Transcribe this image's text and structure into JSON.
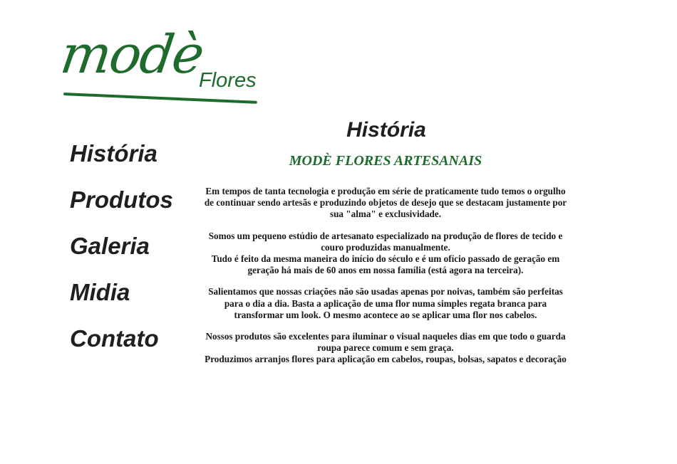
{
  "logo": {
    "word": "modè",
    "sub": "Flores",
    "color": "#1f6b2e"
  },
  "nav": {
    "items": [
      {
        "label": "História"
      },
      {
        "label": "Produtos"
      },
      {
        "label": "Galeria"
      },
      {
        "label": "Midia"
      },
      {
        "label": "Contato"
      }
    ]
  },
  "main": {
    "title": "História",
    "subtitle": "MODÈ FLORES ARTESANAIS",
    "paragraphs": [
      {
        "lines": [
          "Em tempos de tanta tecnologia e produção em série de praticamente tudo temos o orgulho de continuar sendo artesãs e produzindo objetos de desejo que se destacam justamente por sua \"alma\" e exclusividade."
        ]
      },
      {
        "lines": [
          "Somos um pequeno estúdio de artesanato especializado na produção de flores de tecido e couro produzidas manualmente.",
          "Tudo é feito da mesma maneira do início do século e é um ofício passado de geração em geração há mais de 60 anos em nossa família (está agora na terceira)."
        ]
      },
      {
        "lines": [
          "Salientamos que nossas criações não são usadas apenas por noivas, também são perfeitas para o dia a dia. Basta a aplicação de uma flor numa simples regata branca para transformar um look. O mesmo acontece ao se aplicar uma flor nos cabelos."
        ]
      },
      {
        "lines": [
          "Nossos produtos são excelentes para iluminar o visual naqueles dias em que todo o guarda roupa parece comum e sem graça.",
          "Produzimos arranjos flores para aplicação em cabelos, roupas, bolsas, sapatos e decoração"
        ]
      }
    ]
  },
  "colors": {
    "accent": "#1f6b2e",
    "text": "#1a1a1a"
  }
}
